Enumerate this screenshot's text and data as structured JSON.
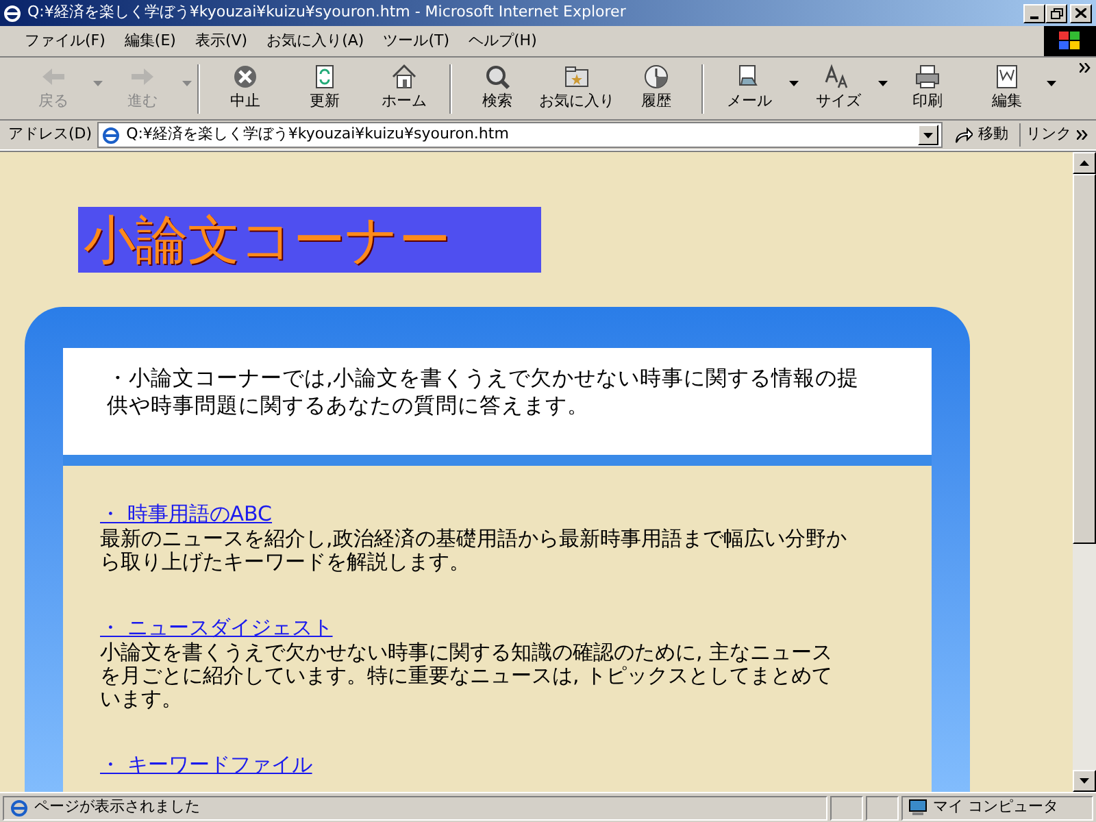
{
  "window": {
    "title": "Q:¥経済を楽しく学ぼう¥kyouzai¥kuizu¥syouron.htm - Microsoft Internet Explorer"
  },
  "menu_bar": [
    "ファイル(F)",
    "編集(E)",
    "表示(V)",
    "お気に入り(A)",
    "ツール(T)",
    "ヘルプ(H)"
  ],
  "toolbar": [
    {
      "kind": "back",
      "label": "戻る",
      "disabled": true,
      "dropdown": true
    },
    {
      "kind": "forward",
      "label": "進む",
      "disabled": true,
      "dropdown": true
    },
    {
      "kind": "stop",
      "label": "中止",
      "disabled": false,
      "dropdown": false
    },
    {
      "kind": "refresh",
      "label": "更新",
      "disabled": false,
      "dropdown": false
    },
    {
      "kind": "home",
      "label": "ホーム",
      "disabled": false,
      "dropdown": false
    },
    {
      "kind": "search",
      "label": "検索",
      "disabled": false,
      "dropdown": false
    },
    {
      "kind": "favorites",
      "label": "お気に入り",
      "disabled": false,
      "dropdown": false
    },
    {
      "kind": "history",
      "label": "履歴",
      "disabled": false,
      "dropdown": false
    },
    {
      "kind": "mail",
      "label": "メール",
      "disabled": false,
      "dropdown": true
    },
    {
      "kind": "size",
      "label": "サイズ",
      "disabled": false,
      "dropdown": true
    },
    {
      "kind": "print",
      "label": "印刷",
      "disabled": false,
      "dropdown": false
    },
    {
      "kind": "edit",
      "label": "編集",
      "disabled": false,
      "dropdown": true
    }
  ],
  "address_bar": {
    "label": "アドレス(D)",
    "value": "Q:¥経済を楽しく学ぼう¥kyouzai¥kuizu¥syouron.htm",
    "go_button": "移動",
    "links": "リンク"
  },
  "page": {
    "heading": "小論文コーナー",
    "intro": "・小論文コーナーでは,小論文を書くうえで欠かせない時事に関する情報の提供や時事問題に関するあなたの質問に答えます。",
    "sections": [
      {
        "link": "・ 時事用語のABC",
        "description": "最新のニュースを紹介し,政治経済の基礎用語から最新時事用語まで幅広い分野から取り上げたキーワードを解説します。"
      },
      {
        "link": "・ ニュースダイジェスト",
        "description": "小論文を書くうえで欠かせない時事に関する知識の確認のために, 主なニュースを月ごとに紹介しています。特に重要なニュースは, トピックスとしてまとめています。"
      },
      {
        "link": "・ キーワードファイル"
      }
    ]
  },
  "status_bar": {
    "text": "ページが表示されました",
    "zone": "マイ コンピュータ"
  }
}
